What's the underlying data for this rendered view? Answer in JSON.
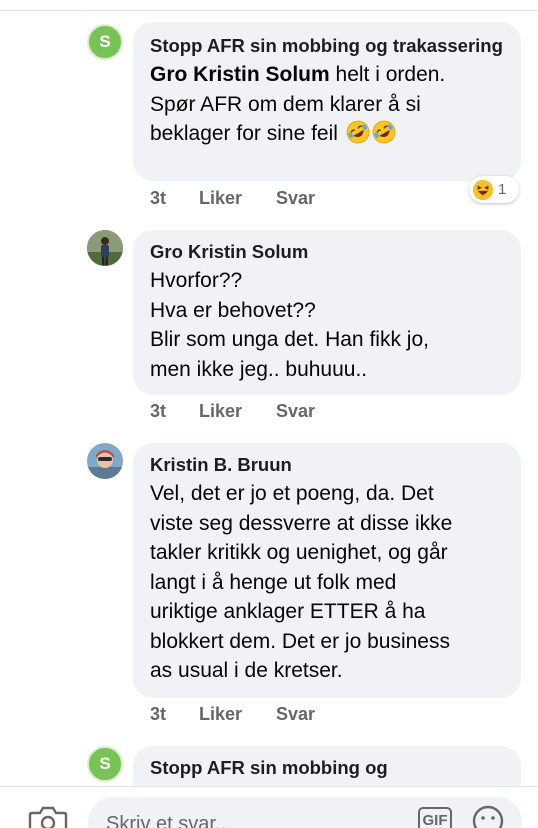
{
  "comments": [
    {
      "author": "Stopp AFR sin mobbing og trakassering",
      "avatar_letter": "S",
      "avatar_color": "#78c257",
      "mention": "Gro Kristin Solum",
      "text_after_mention": " helt i orden.",
      "text_line2": "Spør AFR om dem klarer å si",
      "text_line3": "beklager for sine feil",
      "emoji": "rolling-on-floor-laughing",
      "time": "3t",
      "like_label": "Liker",
      "reply_label": "Svar",
      "reaction": {
        "emoji": "laughing-face",
        "count": "1"
      }
    },
    {
      "author": "Gro Kristin Solum",
      "lines": [
        "Hvorfor??",
        "Hva er behovet??",
        "Blir som unga det. Han fikk jo,",
        "men ikke jeg.. buhuuu.."
      ],
      "time": "3t",
      "like_label": "Liker",
      "reply_label": "Svar"
    },
    {
      "author": "Kristin B. Bruun",
      "lines": [
        "Vel, det er jo et poeng, da. Det",
        "viste seg dessverre at disse ikke",
        "takler kritikk og uenighet, og går",
        "langt i å henge ut folk med",
        "uriktige anklager ETTER  å ha",
        "blokkert dem. Det er jo business",
        "as usual i de kretser."
      ],
      "time": "3t",
      "like_label": "Liker",
      "reply_label": "Svar"
    },
    {
      "author": "Stopp AFR sin mobbing og",
      "avatar_letter": "S"
    }
  ],
  "composer": {
    "placeholder": "Skriv et svar...",
    "gif_label": "GIF"
  }
}
